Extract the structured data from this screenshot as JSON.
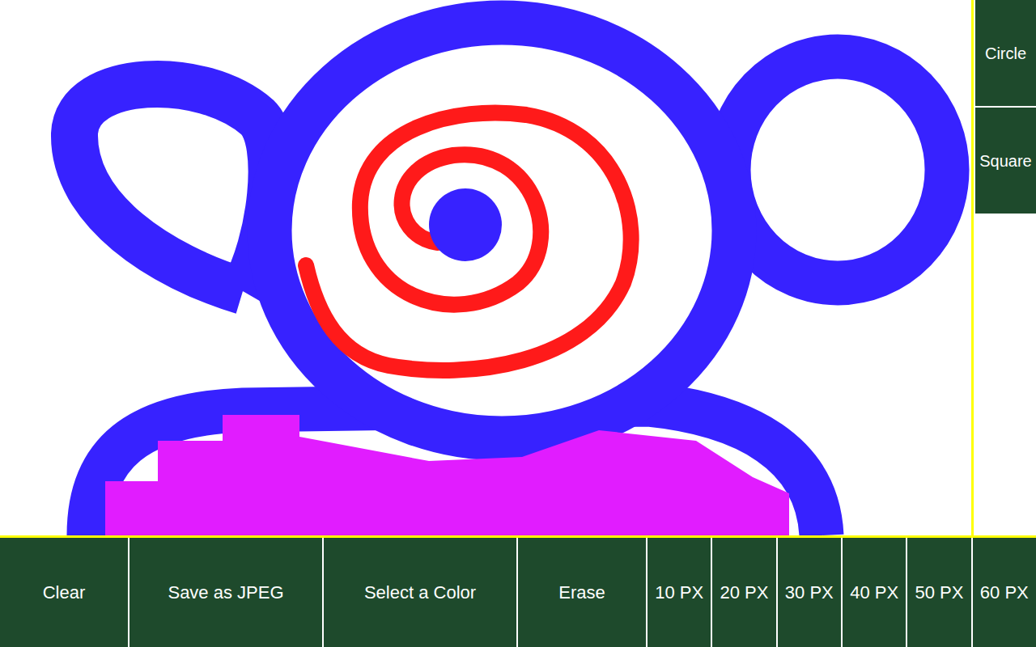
{
  "canvas": {
    "description": "freehand drawing"
  },
  "side_buttons": [
    {
      "label": "Circle"
    },
    {
      "label": "Square"
    }
  ],
  "toolbar": [
    {
      "label": "Clear",
      "kind": "wide"
    },
    {
      "label": "Save as JPEG",
      "kind": "extra"
    },
    {
      "label": "Select a Color",
      "kind": "extra"
    },
    {
      "label": "Erase",
      "kind": "wide"
    }
  ],
  "sizes": [
    "10 PX",
    "20 PX",
    "30 PX",
    "40 PX",
    "50 PX",
    "60 PX"
  ]
}
